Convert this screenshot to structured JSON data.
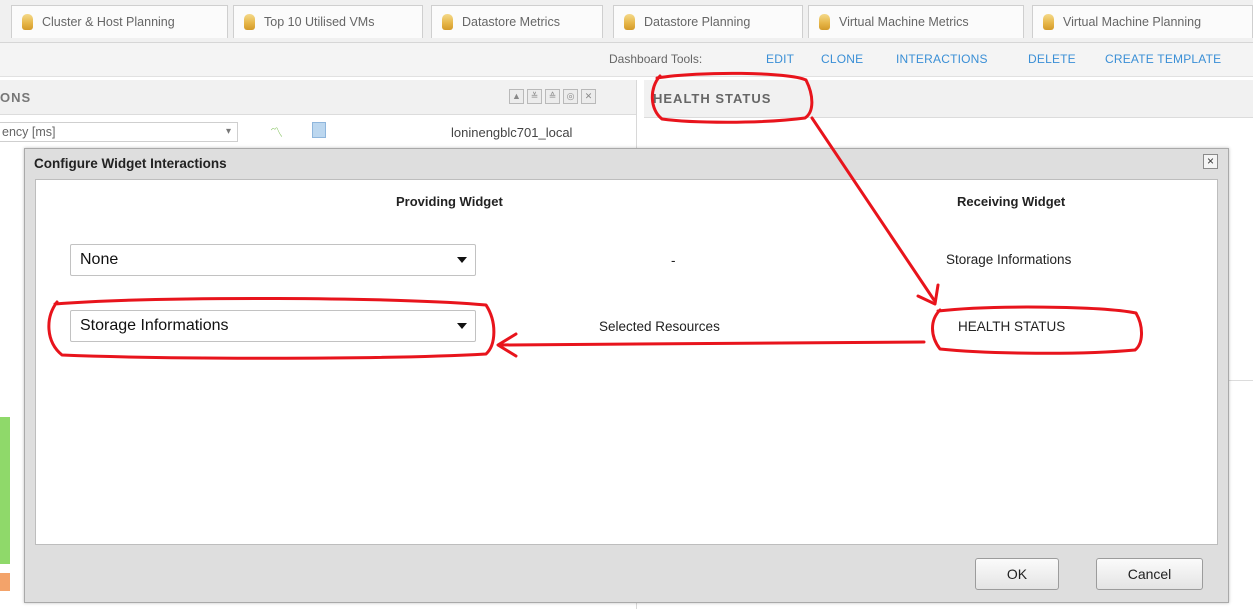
{
  "tabs": [
    {
      "label": "Cluster & Host Planning"
    },
    {
      "label": "Top 10 Utilised VMs"
    },
    {
      "label": "Datastore Metrics"
    },
    {
      "label": "Datastore Planning"
    },
    {
      "label": "Virtual Machine Metrics"
    },
    {
      "label": "Virtual Machine Planning"
    }
  ],
  "toolbar": {
    "label": "Dashboard Tools:",
    "edit": "EDIT",
    "clone": "CLONE",
    "interactions": "INTERACTIONS",
    "delete": "DELETE",
    "create_template": "CREATE TEMPLATE"
  },
  "left_widget": {
    "title": "ONS",
    "metric_select": "ency [ms]",
    "host": "loninengblc701_local"
  },
  "right_widget": {
    "title": "HEALTH STATUS"
  },
  "dialog": {
    "title": "Configure Widget Interactions",
    "close_glyph": "×",
    "providing_header": "Providing Widget",
    "receiving_header": "Receiving Widget",
    "rows": [
      {
        "providing": "None",
        "relation": "-",
        "receiving": "Storage Informations"
      },
      {
        "providing": "Storage Informations",
        "relation": "Selected Resources",
        "receiving": "HEALTH STATUS"
      }
    ],
    "ok": "OK",
    "cancel": "Cancel"
  },
  "colors": {
    "annotation": "#e8141c",
    "link": "#3a8fd6"
  },
  "icons": [
    "tab-icon",
    "chart-icon",
    "table-icon",
    "close-icon",
    "dropdown-caret-icon"
  ]
}
